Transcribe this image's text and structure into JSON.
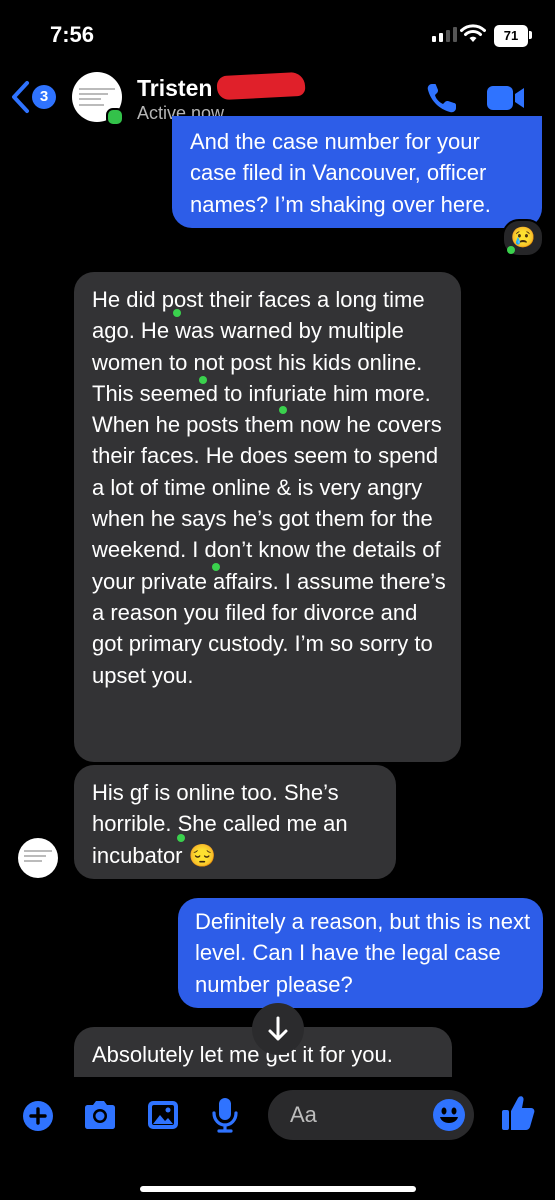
{
  "status_bar": {
    "time": "7:56",
    "battery": "71"
  },
  "header": {
    "back_count": "3",
    "contact_name": "Tristen",
    "contact_status": "Active now",
    "icons": [
      "back-chevron-icon",
      "phone-icon",
      "video-camera-icon"
    ]
  },
  "messages": [
    {
      "direction": "outgoing",
      "text": "And the case number for your case filed in Vancouver, officer names? I’m shaking over here.",
      "reaction": "😢"
    },
    {
      "direction": "incoming",
      "text": "He did post their faces a long time ago. He was warned by multiple women to not post his kids online. This seemed to infuriate him more. When he posts them now he covers their faces. He does seem to spend a lot of time online & is very angry when he says he’s got them for the weekend. I don’t know the details of your private affairs. I assume there’s a reason you filed for divorce and got primary custody. I’m so sorry to upset you."
    },
    {
      "direction": "incoming",
      "text": "His gf is online too. She’s horrible. She called me an incubator 😔"
    },
    {
      "direction": "outgoing",
      "text": "Definitely a reason, but this is next level. Can I have the legal case number please?"
    },
    {
      "direction": "incoming",
      "text": "Absolutely let me get it for you."
    }
  ],
  "composer": {
    "placeholder": "Aa",
    "icons": [
      "plus-icon",
      "camera-icon",
      "photo-icon",
      "microphone-icon",
      "emoji-icon",
      "thumbs-up-icon"
    ]
  },
  "colors": {
    "accent": "#2f73ff",
    "outgoing_bubble": "#2d5de8",
    "incoming_bubble": "#333335",
    "active_green": "#33c24a"
  }
}
